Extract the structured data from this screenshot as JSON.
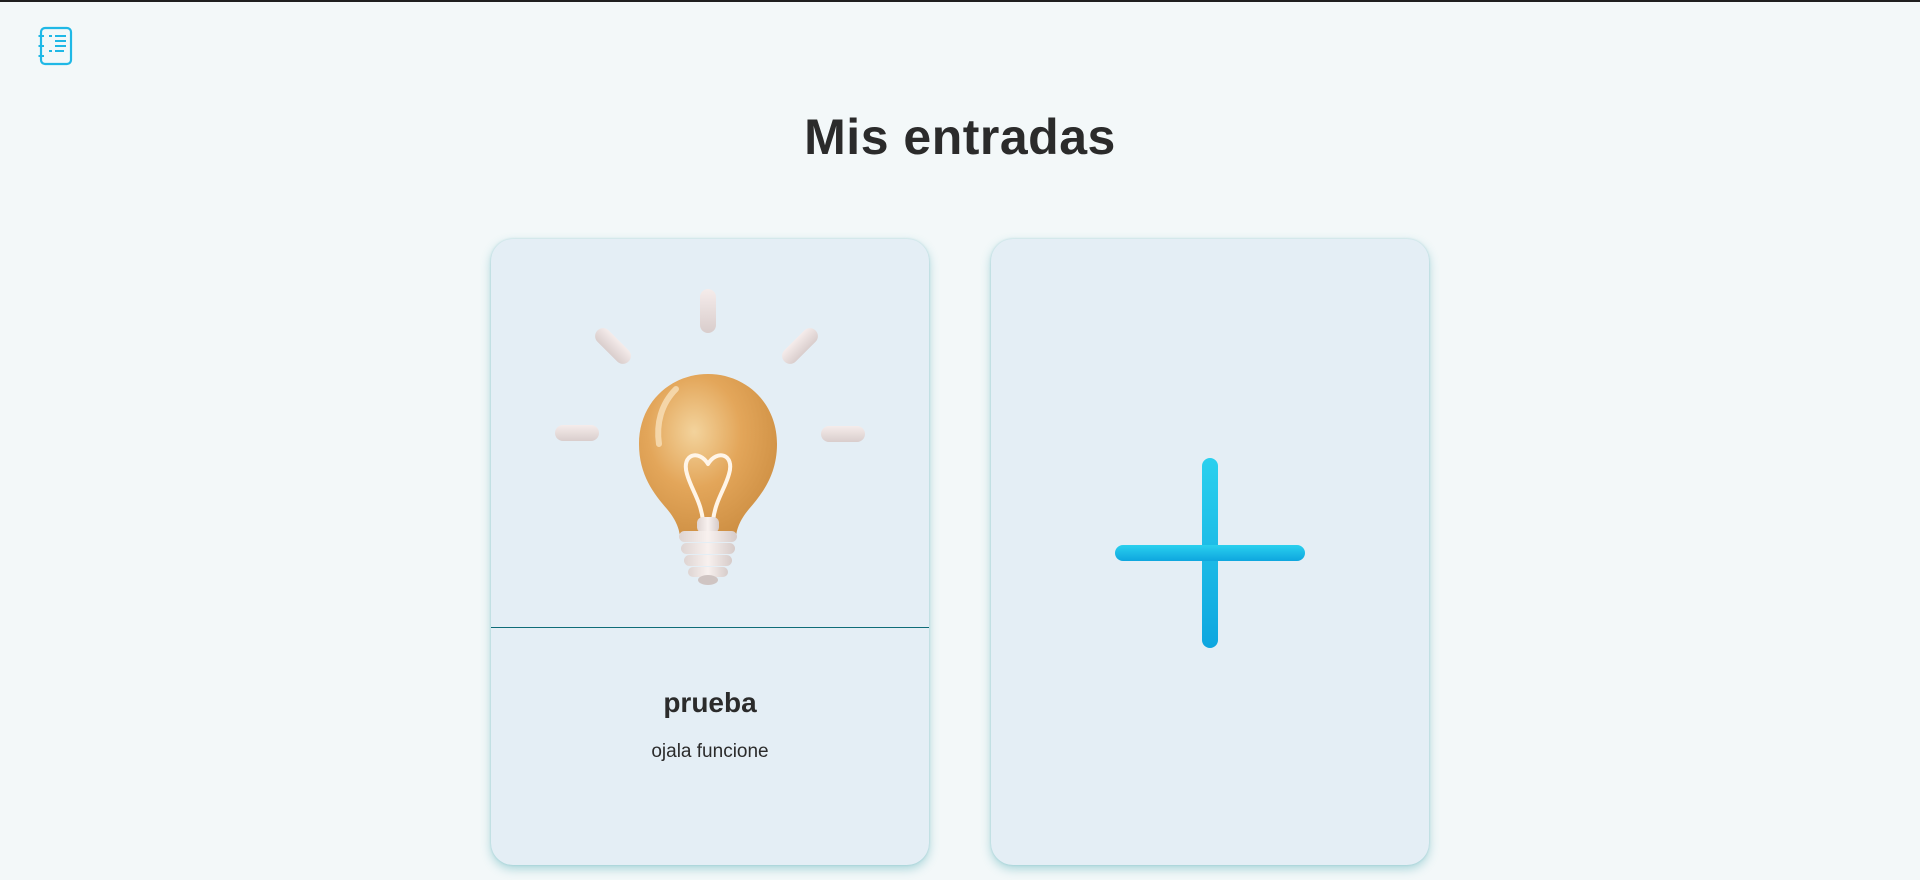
{
  "header": {
    "logo_icon": "notebook-list-icon"
  },
  "main": {
    "title": "Mis entradas",
    "entries": [
      {
        "title": "prueba",
        "description": "ojala funcione",
        "image_icon": "lightbulb-icon"
      }
    ],
    "add_card": {
      "icon": "plus-icon"
    }
  },
  "colors": {
    "background": "#f3f8f9",
    "card_background": "#e4eef5",
    "accent": "#1fb8e6",
    "divider": "#0f6c78",
    "text": "#2b2b2b"
  }
}
